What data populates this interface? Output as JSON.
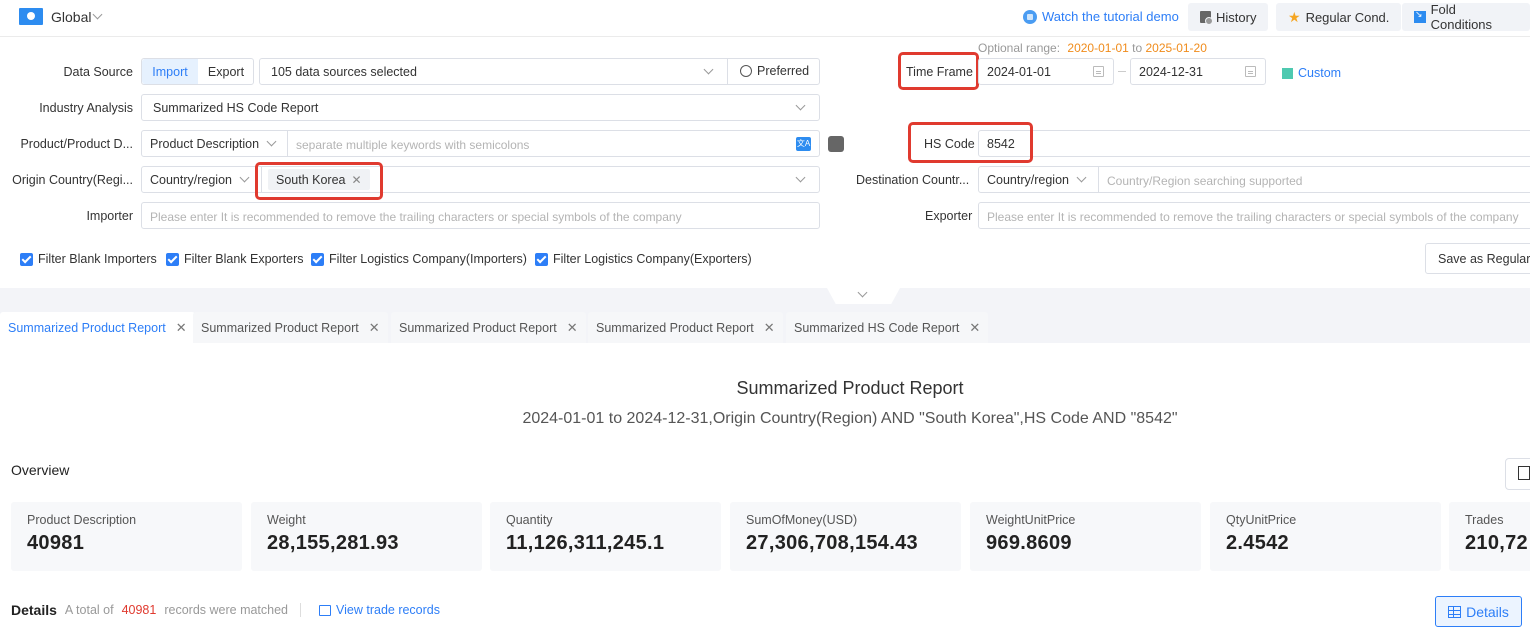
{
  "topbar": {
    "region": "Global",
    "tutorial": "Watch the tutorial demo",
    "history": "History",
    "regular_cond": "Regular Cond.",
    "fold": "Fold Conditions"
  },
  "form": {
    "optional_range_label": "Optional range:",
    "optional_from": "2020-01-01",
    "optional_to_word": "to",
    "optional_to": "2025-01-20",
    "data_source": {
      "label": "Data Source",
      "import": "Import",
      "export": "Export",
      "selected": "105 data sources selected",
      "preferred": "Preferred"
    },
    "time_frame": {
      "label": "Time Frame",
      "start": "2024-01-01",
      "end": "2024-12-31",
      "custom": "Custom"
    },
    "industry": {
      "label": "Industry Analysis",
      "value": "Summarized HS Code Report"
    },
    "product": {
      "label": "Product/Product D...",
      "type": "Product Description",
      "placeholder": "separate multiple keywords with semicolons"
    },
    "hs_code": {
      "label": "HS Code",
      "value": "8542"
    },
    "origin": {
      "label": "Origin Country(Regi...",
      "type": "Country/region",
      "tag": "South Korea"
    },
    "destination": {
      "label": "Destination Countr...",
      "type": "Country/region",
      "placeholder": "Country/Region searching supported"
    },
    "importer": {
      "label": "Importer",
      "placeholder": "Please enter It is recommended to remove the trailing characters or special symbols of the company"
    },
    "exporter": {
      "label": "Exporter",
      "placeholder": "Please enter It is recommended to remove the trailing characters or special symbols of the company"
    },
    "checkboxes": [
      {
        "label": "Filter Blank Importers",
        "checked": true
      },
      {
        "label": "Filter Blank Exporters",
        "checked": true
      },
      {
        "label": "Filter Logistics Company(Importers)",
        "checked": true
      },
      {
        "label": "Filter Logistics Company(Exporters)",
        "checked": true
      }
    ],
    "save_regular": "Save as Regular"
  },
  "tabs": [
    {
      "label": "Summarized Product Report",
      "active": true
    },
    {
      "label": "Summarized Product Report",
      "active": false
    },
    {
      "label": "Summarized Product Report",
      "active": false
    },
    {
      "label": "Summarized Product Report",
      "active": false
    },
    {
      "label": "Summarized HS Code Report",
      "active": false
    }
  ],
  "report": {
    "title": "Summarized Product Report",
    "subtitle": "2024-01-01 to 2024-12-31,Origin Country(Region) AND \"South Korea\",HS Code AND \"8542\"",
    "overview": "Overview",
    "cards": [
      {
        "label": "Product Description",
        "value": "40981"
      },
      {
        "label": "Weight",
        "value": "28,155,281.93"
      },
      {
        "label": "Quantity",
        "value": "11,126,311,245.1"
      },
      {
        "label": "SumOfMoney(USD)",
        "value": "27,306,708,154.43"
      },
      {
        "label": "WeightUnitPrice",
        "value": "969.8609"
      },
      {
        "label": "QtyUnitPrice",
        "value": "2.4542"
      },
      {
        "label": "Trades",
        "value": "210,72"
      }
    ],
    "details": {
      "heading": "Details",
      "prefix": "A total of",
      "count": "40981",
      "suffix": "records were matched",
      "view_link": "View trade records",
      "button": "Details"
    }
  }
}
